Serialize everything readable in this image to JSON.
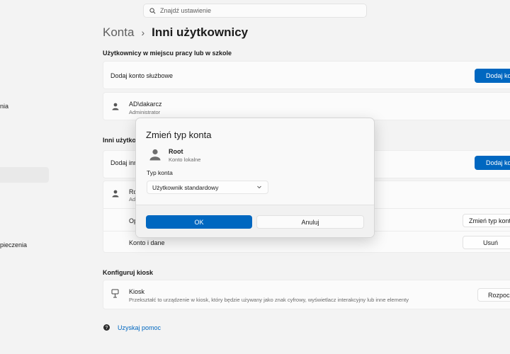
{
  "search": {
    "placeholder": "Znajdź ustawienie"
  },
  "breadcrumb": {
    "parent": "Konta",
    "separator": "›",
    "current": "Inni użytkownicy"
  },
  "sidebar": {
    "fragments": [
      "nia",
      "pieczenia"
    ]
  },
  "work_section": {
    "heading": "Użytkownicy w miejscu pracy lub w szkole",
    "add_label": "Dodaj konto służbowe",
    "add_button": "Dodaj ko",
    "account_name": "AD\\dakarcz",
    "account_role": "Administrator"
  },
  "others_section": {
    "heading": "Inni użytkow",
    "add_label": "Dodaj inn",
    "add_button": "Dodaj ko",
    "user_name": "Ro",
    "user_sub": "Ad",
    "options_label": "Op",
    "change_type_button": "Zmień typ konta",
    "account_data_label": "Konto i dane",
    "remove_button": "Usuń"
  },
  "kiosk_section": {
    "heading": "Konfiguruj kiosk",
    "title": "Kiosk",
    "description": "Przekształć to urządzenie w kiosk, który będzie używany jako znak cyfrowy, wyświetlacz interakcyjny lub inne elementy",
    "start_button": "Rozpocz"
  },
  "help": {
    "label": "Uzyskaj pomoc"
  },
  "dialog": {
    "title": "Zmień typ konta",
    "user_name": "Root",
    "user_type": "Konto lokalne",
    "field_label": "Typ konta",
    "selected_value": "Użytkownik standardowy",
    "ok_label": "OK",
    "cancel_label": "Anuluj"
  },
  "colors": {
    "accent": "#0067c0",
    "background": "#f3f3f3",
    "card": "#fbfbfb"
  }
}
